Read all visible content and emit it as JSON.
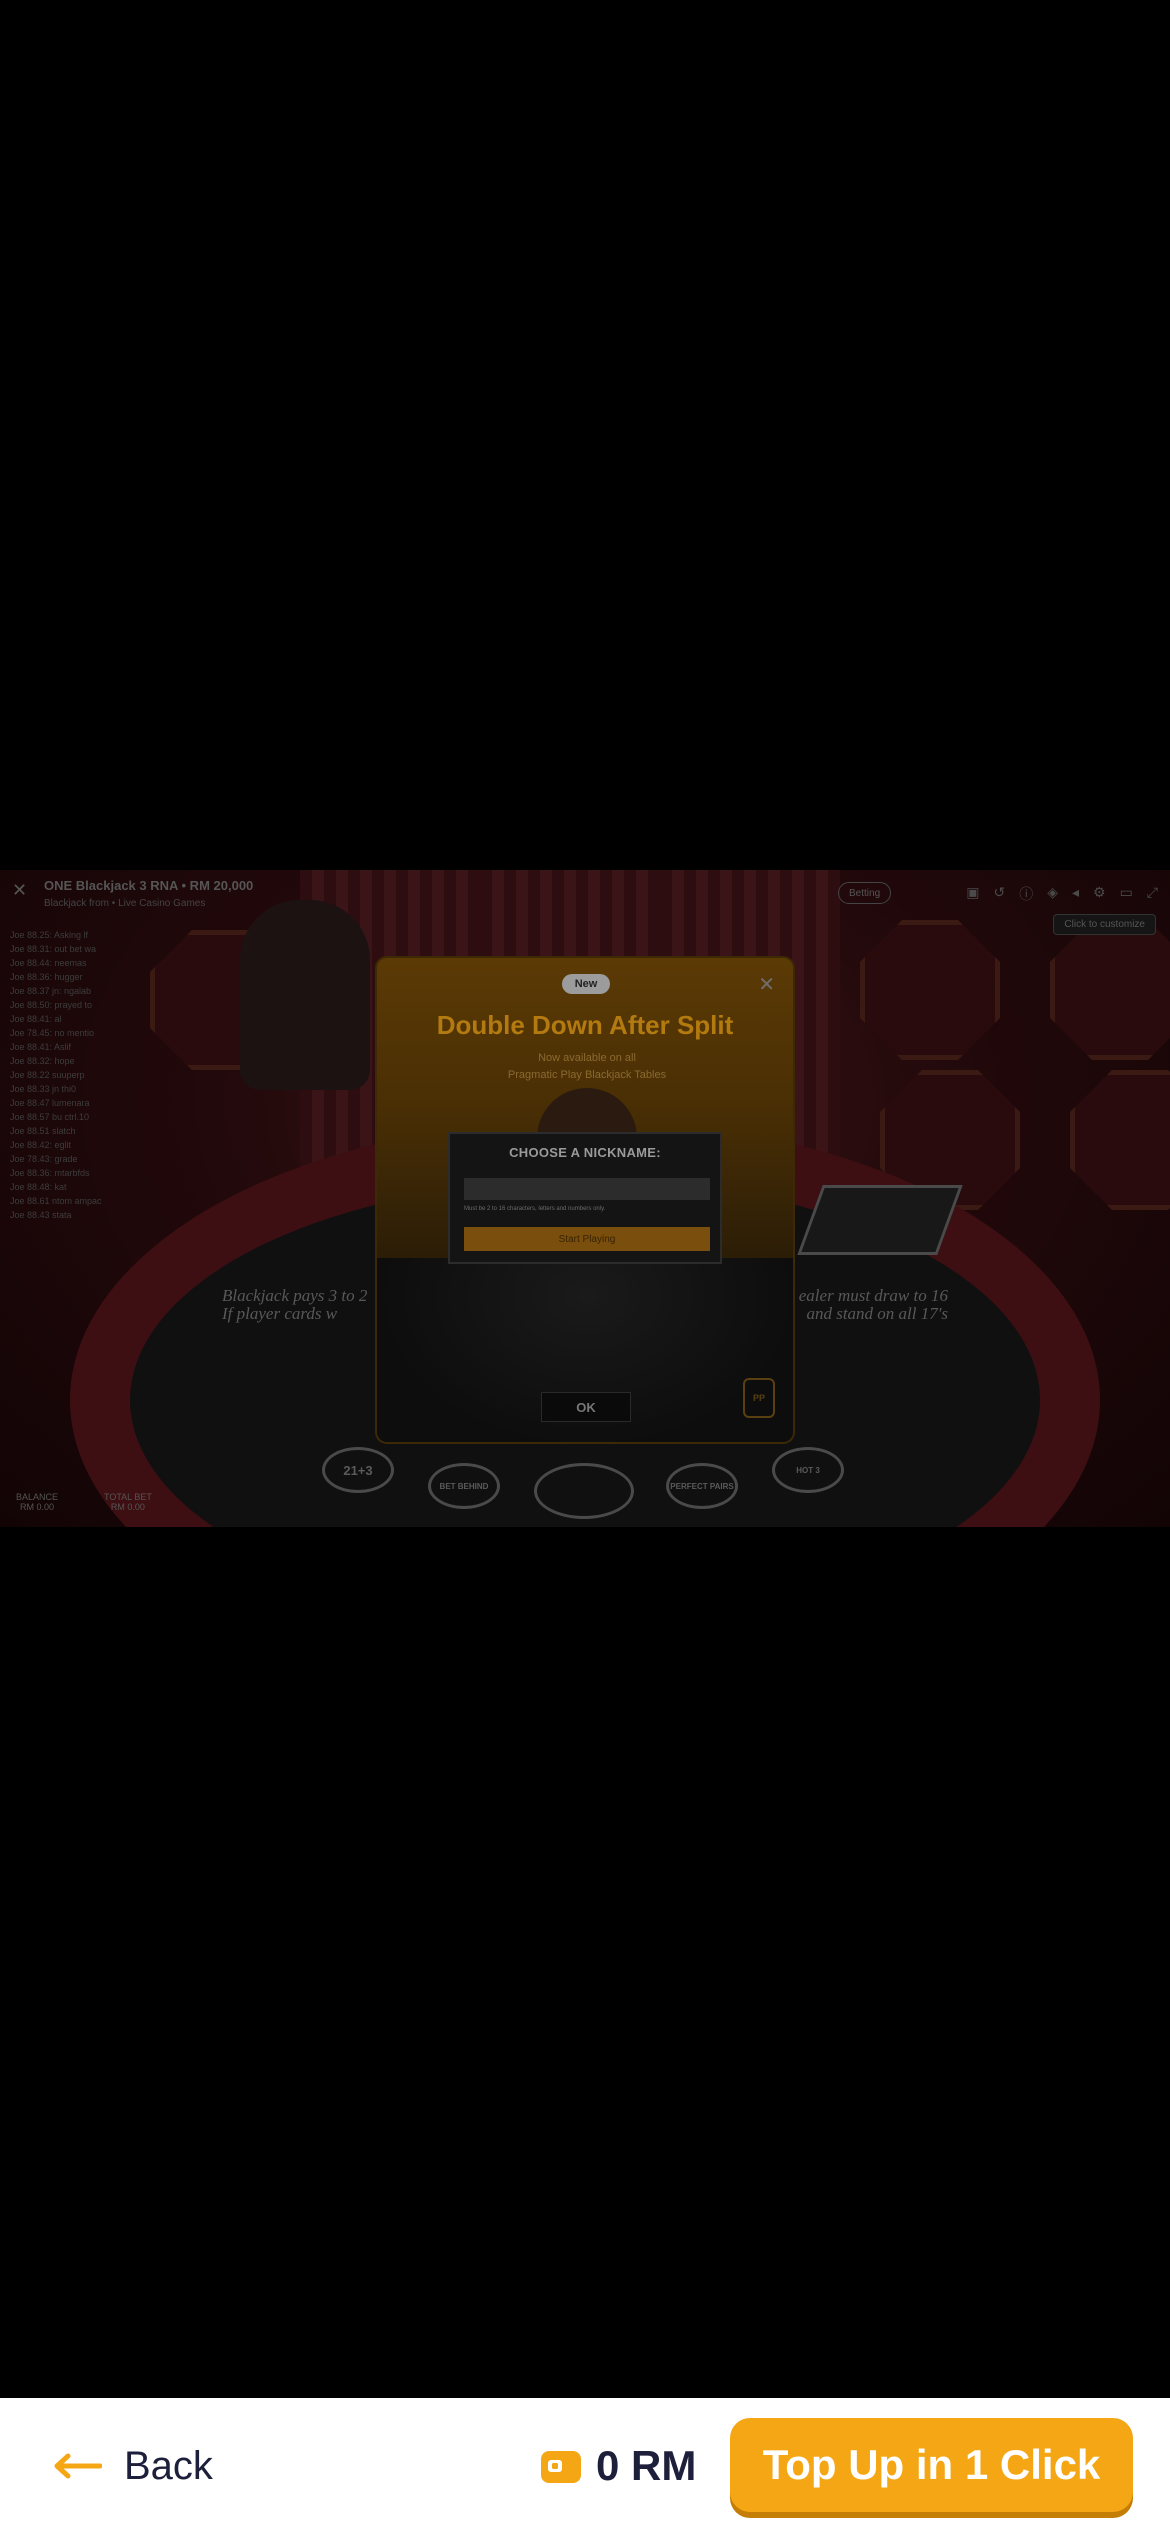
{
  "game": {
    "title": "ONE Blackjack 3 RNA • RM 20,000",
    "subtitle": "Blackjack from • Live Casino Games",
    "status_pill": "Betting",
    "hint": "Click to customize",
    "history": [
      "Joe 88.25: Asking lf",
      "Joe 88.31: out bet wa",
      "Joe 88.44: neemas",
      "Joe 88.36: hugger",
      "Joe 88.37 jn: ngalab",
      "Joe 88.50: prayed to",
      "Joe 88.41: al",
      "Joe 78.45: no mentio",
      "Joe 88.41: Aslif",
      "Joe 88.32: hope",
      "Joe 88.22 suuperp",
      "Joe 88.33 jn thi0",
      "Joe 88.47 lumenara",
      "Joe 88.57 bu ctrl.10",
      "Joe 88.51 slatch",
      "Joe 88.42: eglit",
      "Joe 78.43: grade",
      "Joe 88.36: mtarbfds",
      "Joe 88.48: kat",
      "Joe 88.61 ntom ampac",
      "Joe 88.43 stata"
    ],
    "table_text_left": "Blackjack pays 3 to 2",
    "table_text_left2": "If player cards w",
    "table_text_right": "ealer must draw to 16",
    "table_text_right2": "and stand on all 17's",
    "bet_spots": [
      "21+3",
      "BET BEHIND",
      "",
      "PERFECT PAIRS",
      "HOT 3"
    ],
    "balance_left_label": "BALANCE",
    "balance_left_value": "RM 0.00",
    "balance_right_label": "TOTAL BET",
    "balance_right_value": "RM 0.00"
  },
  "modal": {
    "badge": "New",
    "title": "Double Down After Split",
    "description_line1": "Now available on all",
    "description_line2": "Pragmatic Play Blackjack Tables",
    "ok_label": "OK",
    "logo": "PP"
  },
  "nickname_dialog": {
    "title": "CHOOSE A NICKNAME:",
    "input_value": "",
    "note": "Must be 2 to 16 characters, letters and numbers only.",
    "button": "Start Playing"
  },
  "bottom_bar": {
    "back_label": "Back",
    "balance": "0 RM",
    "topup_label": "Top Up in 1 Click"
  },
  "colors": {
    "accent": "#f5a614",
    "text_dark": "#1e1f3a"
  }
}
